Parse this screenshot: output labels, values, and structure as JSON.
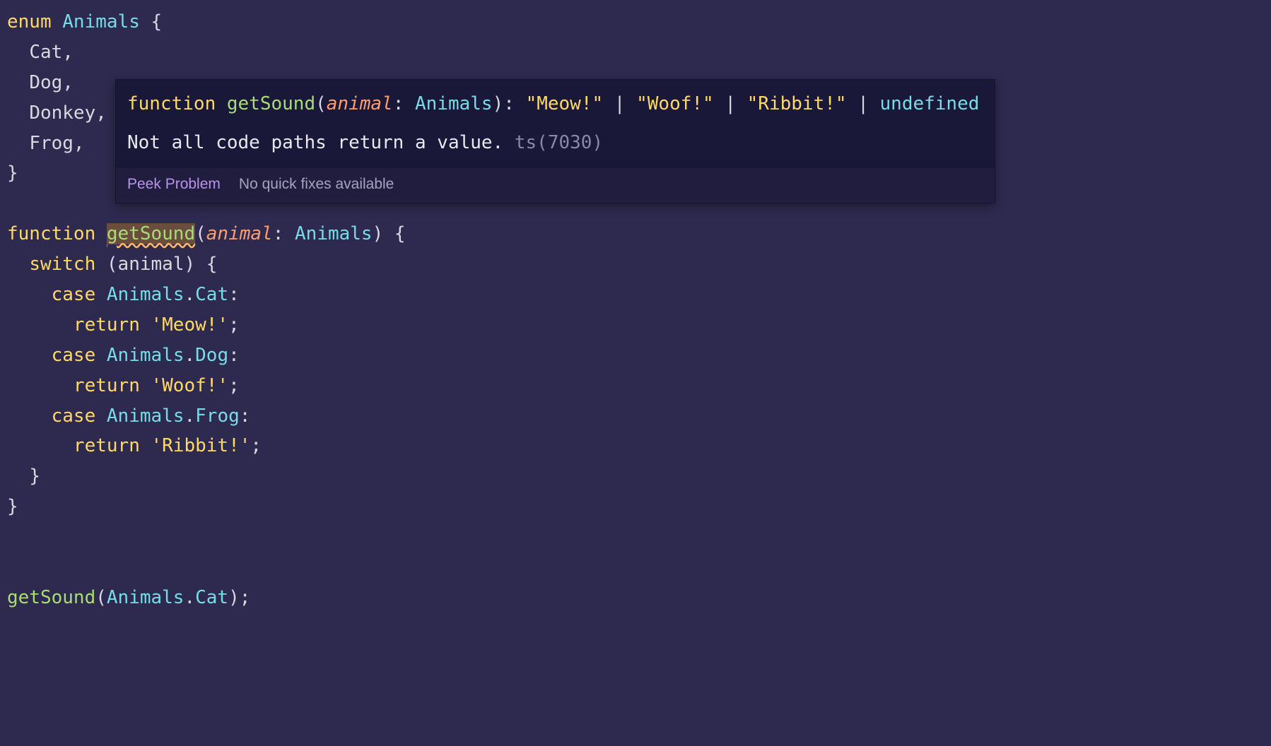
{
  "code": {
    "enum_kw": "enum",
    "enum_name": "Animals",
    "members": {
      "cat": "Cat,",
      "dog": "Dog,",
      "donkey": "Donkey,",
      "frog": "Frog,"
    },
    "function_kw": "function",
    "fn_name": "getSound",
    "param_name": "animal",
    "param_type": "Animals",
    "switch_kw": "switch",
    "case_kw": "case",
    "return_kw": "return",
    "cases": {
      "cat_label": "Cat",
      "cat_value": "'Meow!'",
      "dog_label": "Dog",
      "dog_value": "'Woof!'",
      "frog_label": "Frog",
      "frog_value": "'Ribbit!'"
    },
    "call_fn": "getSound",
    "call_arg_base": "Animals",
    "call_arg_prop": "Cat"
  },
  "hover": {
    "sig": {
      "kw": "function",
      "name": "getSound",
      "param": "animal",
      "ptype": "Animals",
      "ret1": "\"Meow!\"",
      "ret2": "\"Woof!\"",
      "ret3": "\"Ribbit!\"",
      "ret4": "undefined"
    },
    "error_msg": "Not all code paths return a value.",
    "error_code": "ts(7030)",
    "peek_label": "Peek Problem",
    "nofix_label": "No quick fixes available"
  }
}
